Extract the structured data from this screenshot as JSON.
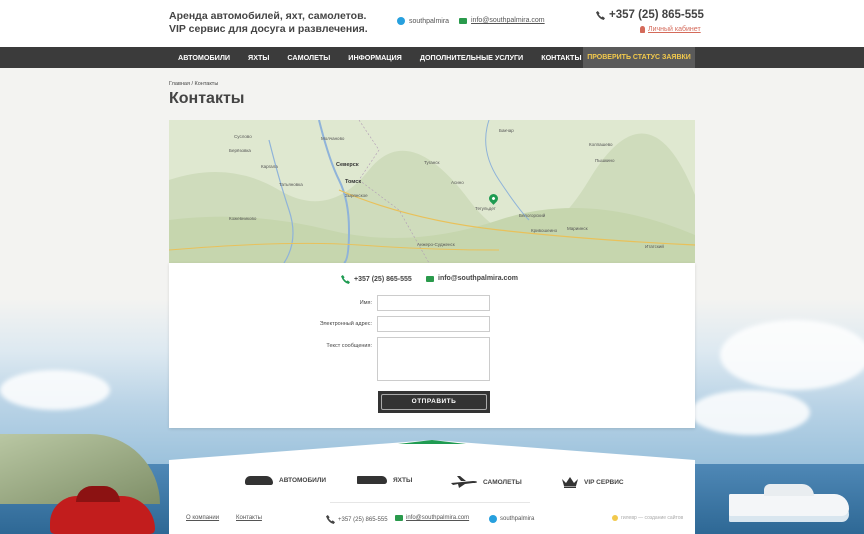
{
  "header": {
    "tagline_line1": "Аренда автомобилей, яхт, самолетов.",
    "tagline_line2": "VIP сервис для досуга и развлечения.",
    "skype": "southpalmira",
    "email": "info@southpalmira.com",
    "phone": "+357 (25) 865-555",
    "cabinet_label": "Личный кабинет"
  },
  "nav": {
    "items": [
      "Автомобили",
      "Яхты",
      "Самолеты",
      "Информация",
      "Дополнительные услуги",
      "Контакты"
    ],
    "status_button": "Проверить статус заявки"
  },
  "breadcrumb": "Главная / Контакты",
  "page_title": "Контакты",
  "map": {
    "labels": [
      "Северск",
      "Томск",
      "Тегульдет",
      "Асино",
      "Анжеро-Судженск",
      "Зырянское",
      "Кожевниково",
      "Мариинск",
      "Туганск",
      "Белогорский",
      "Кривошеино",
      "Молчаново",
      "Бакчар",
      "Колпашево",
      "Каргала",
      "Итатский",
      "Берёзовка",
      "Татьяновка",
      "Пышкино",
      "Суслово"
    ],
    "accent_color": "#1f9b52"
  },
  "contacts": {
    "phone": "+357 (25) 865-555",
    "email": "info@southpalmira.com"
  },
  "form": {
    "name_label": "Имя:",
    "email_label": "Электронный адрес:",
    "message_label": "Текст сообщения:",
    "submit_label": "ОТПРАВИТЬ"
  },
  "footer": {
    "categories": [
      "Автомобили",
      "Яхты",
      "Самолеты",
      "VIP сервис"
    ],
    "links": [
      "О компании",
      "Контакты"
    ],
    "phone": "+357 (25) 865-555",
    "email": "info@southpalmira.com",
    "skype": "southpalmira",
    "credit": "гилевр — создание сайтов"
  }
}
